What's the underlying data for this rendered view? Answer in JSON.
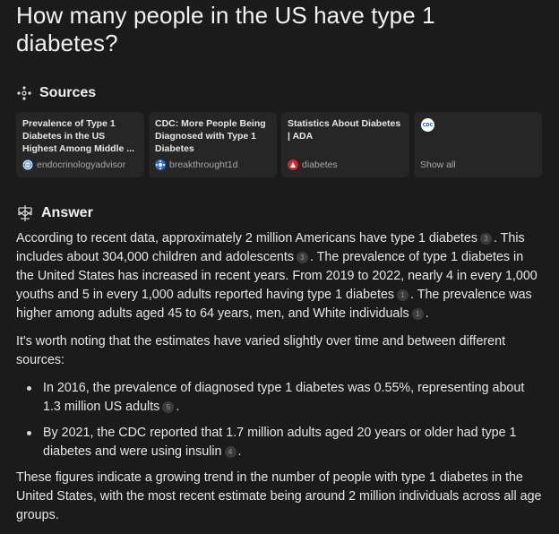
{
  "question": "How many people in the US have type 1 diabetes?",
  "sources": {
    "heading": "Sources",
    "cards": [
      {
        "title": "Prevalence of Type 1 Diabetes in the US Highest Among Middle ...",
        "source": "endocrinologyadvisor",
        "icon": "globe-icon"
      },
      {
        "title": "CDC: More People Being Diagnosed with Type 1 Diabetes",
        "source": "breakthrought1d",
        "icon": "breakthrough-t1d-icon"
      },
      {
        "title": "Statistics About Diabetes | ADA",
        "source": "diabetes",
        "icon": "ada-icon"
      }
    ],
    "show_all": {
      "badge": "CDC",
      "label": "Show all"
    }
  },
  "answer": {
    "heading": "Answer",
    "p1": {
      "t1": "According to recent data, approximately 2 million Americans have type 1 diabetes",
      "c1": "3",
      "t2": ". This includes about 304,000 children and adolescents",
      "c2": "3",
      "t3": ". The prevalence of type 1 diabetes in the United States has increased in recent years. From 2019 to 2022, nearly 4 in every 1,000 youths and 5 in every 1,000 adults reported having type 1 diabetes",
      "c3": "1",
      "t4": ". The prevalence was higher among adults aged 45 to 64 years, men, and White individuals",
      "c4": "1",
      "t5": "."
    },
    "p2": "It's worth noting that the estimates have varied slightly over time and between different sources:",
    "bullets": [
      {
        "text": "In 2016, the prevalence of diagnosed type 1 diabetes was 0.55%, representing about 1.3 million US adults",
        "cite": "5",
        "end": "."
      },
      {
        "text": "By 2021, the CDC reported that 1.7 million adults aged 20 years or older had type 1 diabetes and were using insulin",
        "cite": "4",
        "end": "."
      }
    ],
    "p3": "These figures indicate a growing trend in the number of people with type 1 diabetes in the United States, with the most recent estimate being around 2 million individuals across all age groups."
  },
  "colors": {
    "background": "#1b1b1b",
    "card": "#262626",
    "text": "#e6e6e6",
    "muted": "#a8a8a8"
  }
}
